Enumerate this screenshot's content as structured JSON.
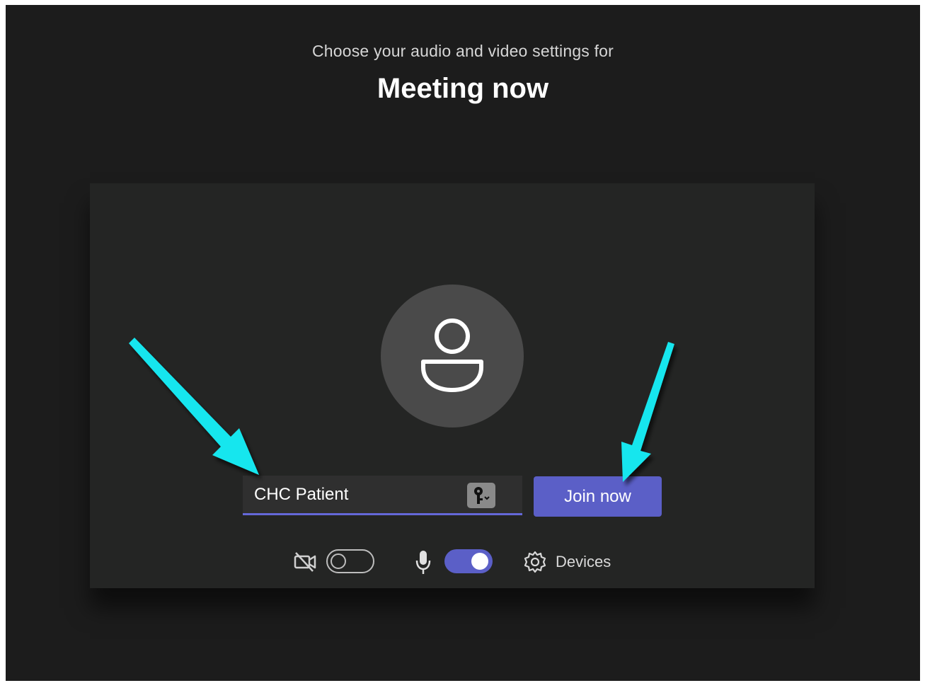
{
  "header": {
    "subtitle": "Choose your audio and video settings for",
    "title": "Meeting now"
  },
  "prejoin": {
    "name_value": "CHC Patient",
    "join_label": "Join now",
    "camera_toggle": "off",
    "mic_toggle": "on",
    "devices_label": "Devices"
  },
  "colors": {
    "accent": "#5b5fc7",
    "arrow": "#19e6ee",
    "background": "#1c1c1c",
    "panel": "#242524"
  },
  "icons": {
    "avatar": "person-icon",
    "key": "key-icon",
    "camera": "camera-off-icon",
    "mic": "microphone-icon",
    "devices": "gear-icon"
  }
}
